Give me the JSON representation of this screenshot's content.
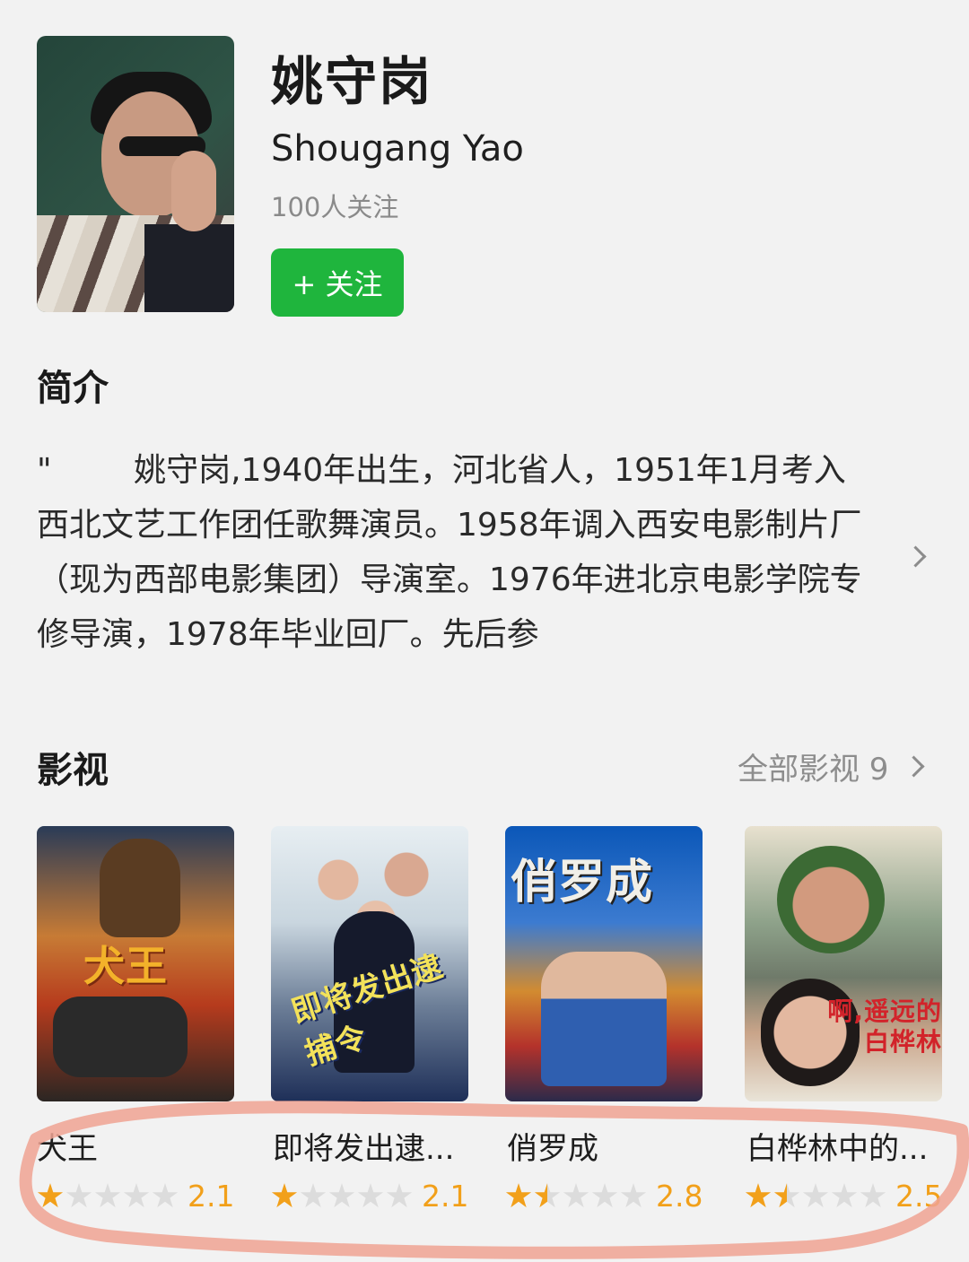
{
  "profile": {
    "name_cn": "姚守岗",
    "name_en": "Shougang Yao",
    "followers": "100人关注",
    "follow_label": "+ 关注"
  },
  "intro": {
    "title": "简介",
    "text": "\"        姚守岗,1940年出生，河北省人，1951年1月考入西北文艺工作团任歌舞演员。1958年调入西安电影制片厂（现为西部电影集团）导演室。1976年进北京电影学院专修导演，1978年毕业回厂。先后参"
  },
  "media": {
    "title": "影视",
    "all_label": "全部影视 9",
    "items": [
      {
        "title": "犬王",
        "poster_text": "犬王",
        "rating": 2.1,
        "score_label": "2.1",
        "stars": 1
      },
      {
        "title": "即将发出逮...",
        "poster_text": "即将发出逮捕令",
        "rating": 2.1,
        "score_label": "2.1",
        "stars": 1
      },
      {
        "title": "俏罗成",
        "poster_text": "俏罗成",
        "rating": 2.8,
        "score_label": "2.8",
        "stars": 1.5
      },
      {
        "title": "白桦林中的...",
        "poster_text": "啊,遥远的白桦林",
        "rating": 2.5,
        "score_label": "2.5",
        "stars": 1.5
      }
    ]
  },
  "colors": {
    "accent": "#1fb53d",
    "star": "#f2a01a",
    "highlight": "#f0a393"
  },
  "icons": [
    "chevron-right-icon",
    "star-icon"
  ]
}
